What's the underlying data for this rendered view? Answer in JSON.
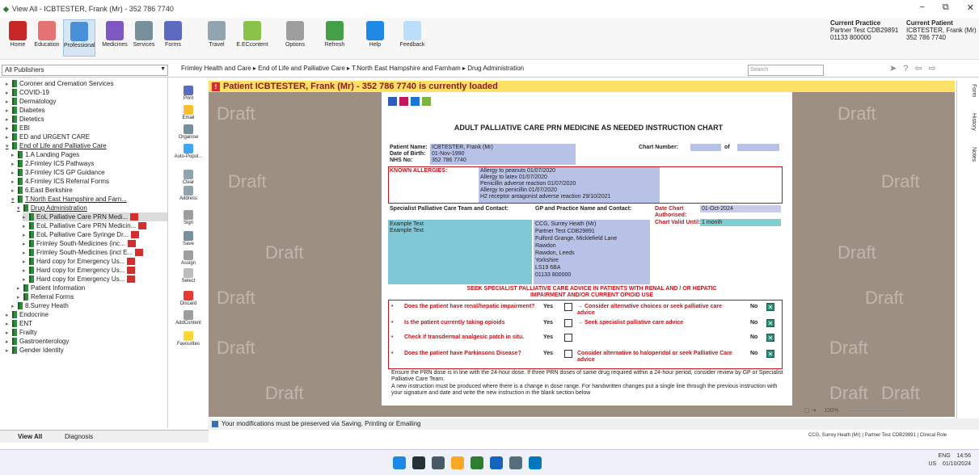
{
  "window": {
    "title": "View All - ICBTESTER, Frank (Mr) - 352 786 7740",
    "controls": [
      "−",
      "⧉",
      "✕"
    ]
  },
  "ribbon": {
    "buttons": [
      "Home",
      "Education",
      "Professional",
      "Medicines",
      "Services",
      "Forms",
      "Travel",
      "E.ECcontent",
      "Options",
      "Refresh",
      "Help",
      "Feedback"
    ]
  },
  "current_practice": {
    "heading": "Current Practice",
    "line1": "Partner Test CDB29891",
    "line2": "01133 800000"
  },
  "current_patient": {
    "heading": "Current Patient",
    "line1": "ICBTESTER, Frank (Mr)",
    "line2": "352 786 7740"
  },
  "publishers": {
    "selected": "All Publishers"
  },
  "breadcrumb": "Frimley Health and Care  ▸  End of Life and Palliative Care  ▸  T.North East Hampshire and Farnham  ▸  Drug Administration",
  "search": {
    "placeholder": "Search"
  },
  "tree": [
    "Coroner and Cremation Services",
    "COVID-19",
    "Dermatology",
    "Diabetes",
    "Dietetics",
    "EBI",
    "ED and URGENT CARE",
    "End of Life and Palliative Care",
    "1.A Landing Pages",
    "2.Frimley ICS Pathways",
    "3.Frimley ICS GP Guidance",
    "4.Frimley ICS Referral Forms",
    "6.East Berkshire",
    "T.North East Hampshire and Farn...",
    "Drug Administration",
    "EoL Palliative Care PRN Medi...",
    "EoL Palliative Care PRN Medicin...",
    "EoL Palliative Care Syringe Dr...",
    "Frimley South-Medicines (inc...",
    "Frimley South-Medicines (incl E...",
    "Hard copy for Emergency Us...",
    "Hard copy for Emergency Us...",
    "Hard copy for Emergency Us...",
    "Patient Information",
    "Referral Forms",
    "8.Surrey Heath",
    "Endocrine",
    "ENT",
    "Frailty",
    "Gastroenterology",
    "Gender Identity"
  ],
  "bottom_tabs": {
    "view_all": "View All",
    "diagnosis": "Diagnosis"
  },
  "side_tools": [
    "Print",
    "Email",
    "Organise",
    "Auto-Popul...",
    "Clear",
    "Address",
    "Sign",
    "Save",
    "Assign",
    "Select",
    "Discard",
    "AddContent",
    "Favourites"
  ],
  "banner": "Patient ICBTESTER, Frank (Mr) - 352 786 7740 is currently loaded",
  "watermark": "Draft",
  "right_tabs": [
    "Form",
    "History",
    "Notes"
  ],
  "document": {
    "title": "ADULT PALLIATIVE CARE PRN MEDICINE AS NEEDED INSTRUCTION CHART",
    "patient_name_label": "Patient Name:",
    "patient_name": "ICBTESTER, Frank (Mr)",
    "dob_label": "Date of Birth:",
    "dob": "01-Nov-1990",
    "nhs_label": "NHS No:",
    "nhs": "352 786 7740",
    "chart_number_label": "Chart Number:",
    "of_label": "of",
    "allergies_label": "KNOWN ALLERGIES:",
    "allergies": [
      "Allergy to peanuts 01/07/2020",
      "Allergy to latex 01/07/2020",
      "Penicillin adverse reaction 01/07/2020",
      "Allergy to penicillin 01/07/2020",
      "H2 receptor antagonist adverse reaction 29/10/2021"
    ],
    "team_label": "Specialist Palliative Care Team and Contact:",
    "gp_label": "GP and Practice Name and Contact:",
    "date_chart_label": "Date Chart Authorised:",
    "date_chart": "01-Oct-2024",
    "valid_label": "Chart Valid Until:",
    "valid": "1 month",
    "team_lines": [
      "Example Text",
      "Example Text"
    ],
    "gp_lines": [
      "CCG, Surrey Heath (Mr)",
      "Partner Test CDB29891",
      "Fulford Grange, Micklefield Lane",
      "Rawdon",
      "Rawdon, Leeds",
      "Yorkshire",
      "LS19 6BA",
      "01133 800000"
    ],
    "advice": "SEEK SPECIALIST PALLIATIVE CARE ADVICE IN PATIENTS WITH RENAL AND / OR HEPATIC IMPAIRMENT AND/OR CURRENT OPIOID USE",
    "questions": [
      {
        "q": "Does the patient have renal/hepatic impairment?",
        "yes": "Yes",
        "action": "→ Consider alternative choices or seek palliative care advice",
        "no": "No"
      },
      {
        "q": "Is the patient currently taking opioids",
        "yes": "Yes",
        "action": "→ Seek specialist palliative care advice",
        "no": "No"
      },
      {
        "q": "Check if transdermal analgesic patch in situ.",
        "yes": "Yes",
        "action": "",
        "no": "No"
      },
      {
        "q": "Does the patient have Parkinsons Disease?",
        "yes": "Yes",
        "action": "Consider alternative to haloperidol or seek Palliative Care advice",
        "no": "No"
      }
    ],
    "note1": "Ensure the PRN dose is in line with the 24-hour dose. If three PRN doses of same drug required within a 24-hour period, consider review by GP or Specialist Palliative Care Team.",
    "note2": "A new instruction must be produced where there is a change in dose range. For handwritten changes put a single line through the previous instruction with your signature and date and write the new instruction in the blank section below"
  },
  "zoom": "100%",
  "status": "Your modifications must be preserved via Saving, Printing or Emailing",
  "footer_status": [
    "CCG, Surrey Heath (Mr)",
    "Partner Test CDB29891",
    "Clinical Role"
  ],
  "tray": {
    "lang": "ENG",
    "region": "US",
    "time": "14:56",
    "date": "01/10/2024"
  }
}
